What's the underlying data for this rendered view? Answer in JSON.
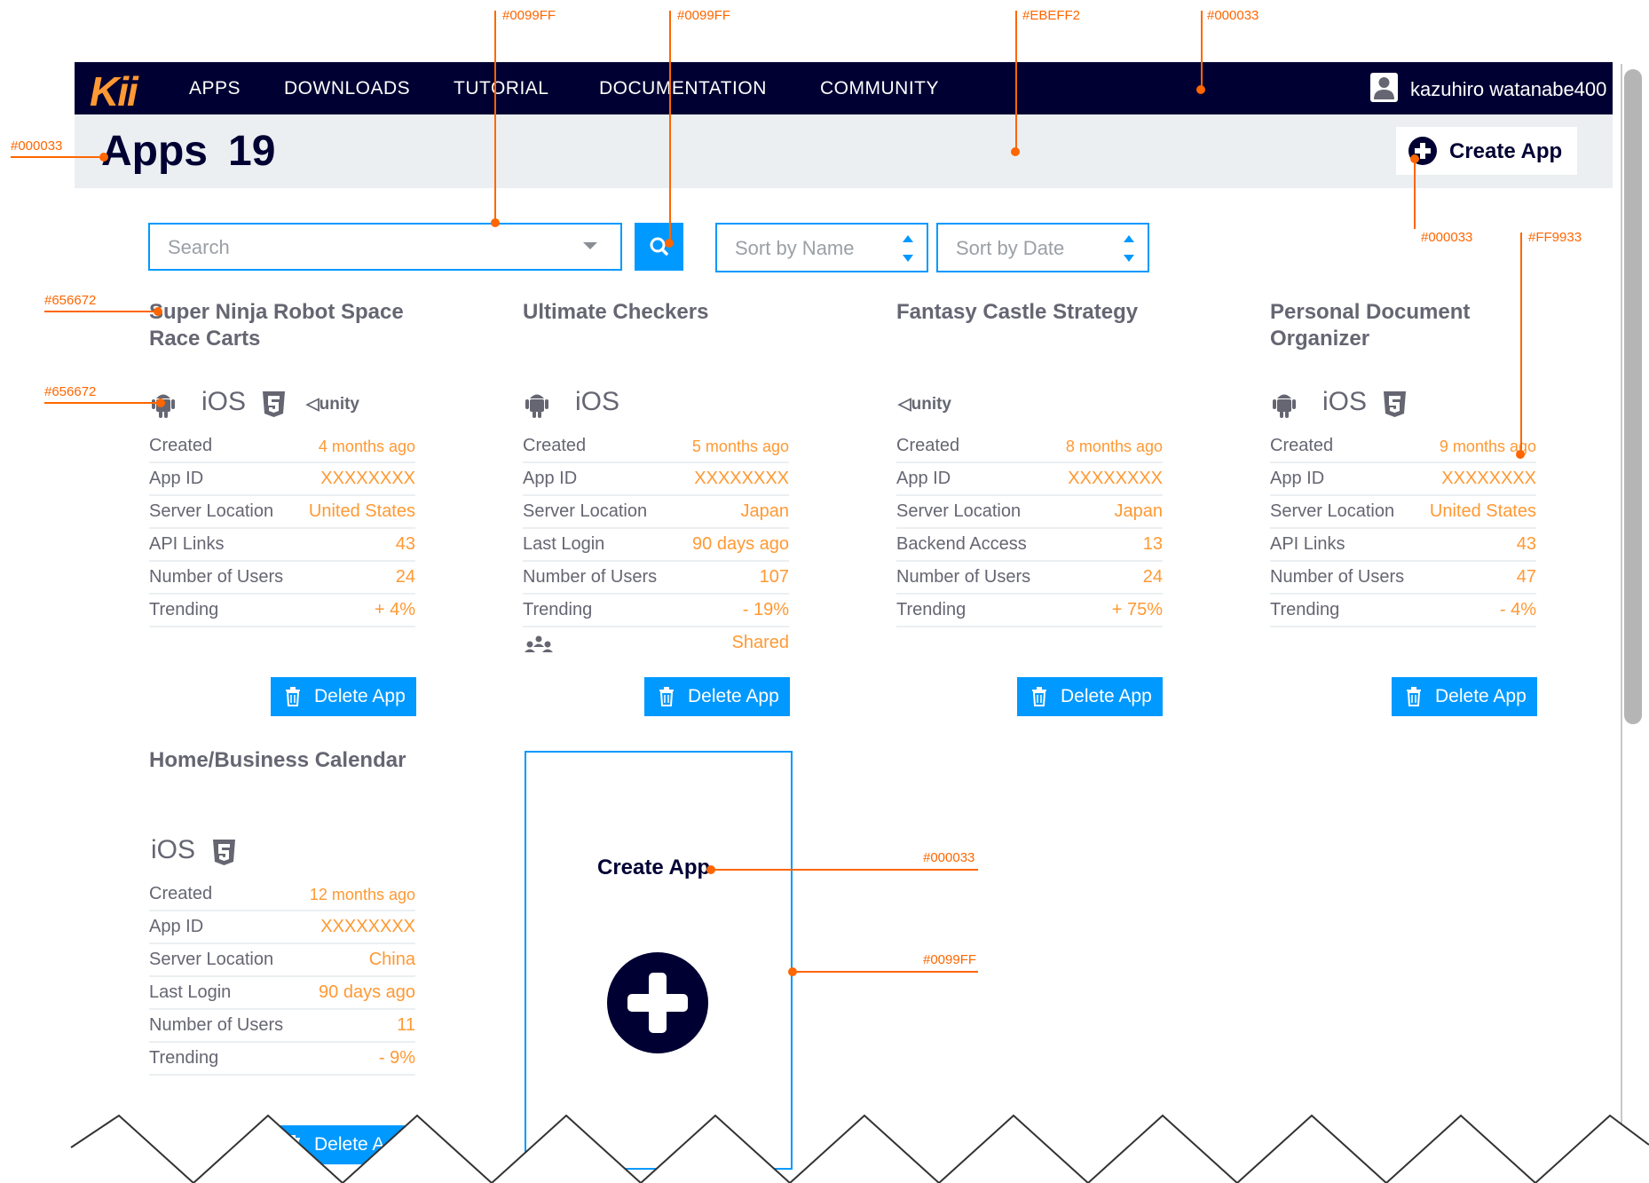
{
  "annotations": {
    "search_border": "#0099FF",
    "search_button": "#0099FF",
    "header_bg": "#EBEFF2",
    "nav_bg": "#000033",
    "title_color": "#000033",
    "create_btn_color": "#000033",
    "accent_orange": "#FF9933",
    "card_title_color": "#656672",
    "platform_icon_color": "#656672",
    "new_app_label_color": "#000033",
    "new_app_border": "#0099FF"
  },
  "nav": {
    "logo": "Kii",
    "items": [
      "APPS",
      "DOWNLOADS",
      "TUTORIAL",
      "DOCUMENTATION",
      "COMMUNITY"
    ],
    "user_name": "kazuhiro watanabe400",
    "user_icon": "user-avatar-icon"
  },
  "header": {
    "title": "Apps",
    "count": "19",
    "create_label": "Create App"
  },
  "toolbar": {
    "search_placeholder": "Search",
    "sort_name": "Sort by Name",
    "sort_date": "Sort by Date"
  },
  "cards": [
    {
      "title": "Super Ninja Robot Space Race Carts",
      "platforms": [
        "android",
        "iOS",
        "html5",
        "unity"
      ],
      "rows": [
        {
          "k": "Created",
          "v": "4 months ago",
          "small": true
        },
        {
          "k": "App ID",
          "v": "XXXXXXXX"
        },
        {
          "k": "Server Location",
          "v": "United States"
        },
        {
          "k": "API Links",
          "v": "43"
        },
        {
          "k": "Number of Users",
          "v": "24"
        },
        {
          "k": "Trending",
          "v": "+ 4%"
        }
      ],
      "delete_label": "Delete App"
    },
    {
      "title": "Ultimate Checkers",
      "platforms": [
        "android",
        "iOS"
      ],
      "rows": [
        {
          "k": "Created",
          "v": "5 months ago",
          "small": true
        },
        {
          "k": "App ID",
          "v": "XXXXXXXX"
        },
        {
          "k": "Server Location",
          "v": "Japan"
        },
        {
          "k": "Last Login",
          "v": "90 days ago"
        },
        {
          "k": "Number of Users",
          "v": "107"
        },
        {
          "k": "Trending",
          "v": "- 19%"
        }
      ],
      "shared_label": "Shared",
      "delete_label": "Delete App"
    },
    {
      "title": "Fantasy Castle Strategy",
      "platforms": [
        "unity"
      ],
      "rows": [
        {
          "k": "Created",
          "v": "8 months ago",
          "small": true
        },
        {
          "k": "App ID",
          "v": "XXXXXXXX"
        },
        {
          "k": "Server Location",
          "v": "Japan"
        },
        {
          "k": "Backend Access",
          "v": "13"
        },
        {
          "k": "Number of Users",
          "v": "24"
        },
        {
          "k": "Trending",
          "v": "+ 75%"
        }
      ],
      "delete_label": "Delete App"
    },
    {
      "title": "Personal Document Organizer",
      "platforms": [
        "android",
        "iOS",
        "html5"
      ],
      "rows": [
        {
          "k": "Created",
          "v": "9 months ago",
          "small": true
        },
        {
          "k": "App ID",
          "v": "XXXXXXXX"
        },
        {
          "k": "Server Location",
          "v": "United States"
        },
        {
          "k": "API Links",
          "v": "43"
        },
        {
          "k": "Number of Users",
          "v": "47"
        },
        {
          "k": "Trending",
          "v": "- 4%"
        }
      ],
      "delete_label": "Delete App"
    },
    {
      "title": "Home/Business Calendar",
      "platforms": [
        "iOS",
        "html5"
      ],
      "rows": [
        {
          "k": "Created",
          "v": "12 months ago",
          "small": true
        },
        {
          "k": "App ID",
          "v": "XXXXXXXX"
        },
        {
          "k": "Server Location",
          "v": "China"
        },
        {
          "k": "Last Login",
          "v": "90 days ago"
        },
        {
          "k": "Number of Users",
          "v": "11"
        },
        {
          "k": "Trending",
          "v": "- 9%"
        }
      ],
      "delete_label": "Delete A"
    }
  ],
  "new_app_card": {
    "label": "Create App"
  }
}
